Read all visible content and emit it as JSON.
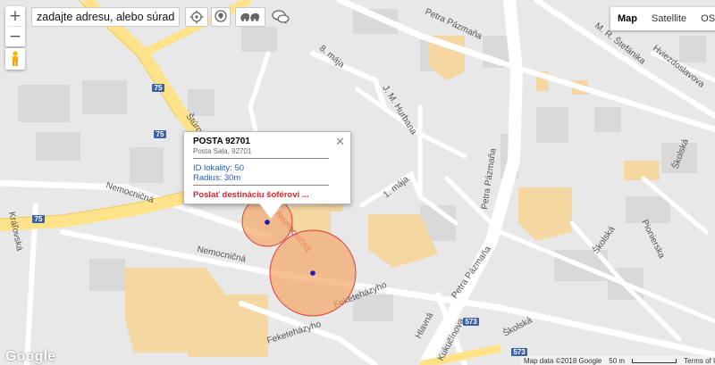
{
  "search": {
    "placeholder": "zadajte adresu, alebo súradnice"
  },
  "zoom": {
    "in_label": "+",
    "out_label": "−"
  },
  "map_types": [
    {
      "label": "Map",
      "active": true
    },
    {
      "label": "Satellite",
      "active": false
    },
    {
      "label": "OSM",
      "active": false
    }
  ],
  "tools": [
    "crosshair-icon",
    "marker-icon",
    "vehicles-icon",
    "chat-icon"
  ],
  "popup": {
    "title": "POSTA 92701",
    "subtitle": "Posta Sala, 92701",
    "id_line": "ID lokality: 50",
    "radius_line": "Radius: 30m",
    "action": "Poslať destináciu šoférovi ..."
  },
  "streets": [
    "Štúrova",
    "Nemocničná",
    "Nemocničná",
    "Nemocničná",
    "Kráľovská",
    "Hlavná",
    "J. M. Hurbana",
    "8. mája",
    "1. mája",
    "Petra Pázmaňa",
    "Petra Pázmaňa",
    "Feketeházyho",
    "Feketeházyho",
    "Školská",
    "Školská",
    "Školská",
    "Pionierska",
    "M. R. Štefánika",
    "Hviezdoslavova",
    "Kukučínova",
    "Petra Pázmaňa"
  ],
  "road_shields": [
    "75",
    "75",
    "75",
    "573",
    "573"
  ],
  "footer": {
    "google": "Google",
    "map_data": "Map data ©2018 Google",
    "scale": "50 m",
    "terms": "Terms of Use"
  },
  "colors": {
    "major_road": "#ffe38a",
    "building": "#d9d9d9",
    "highlight_building": "#f5d7a1",
    "geofence_fill": "#f3a766",
    "geofence_stroke": "#e43b3b",
    "marker": "#1a1ab5",
    "popup_link": "#d9262c"
  }
}
